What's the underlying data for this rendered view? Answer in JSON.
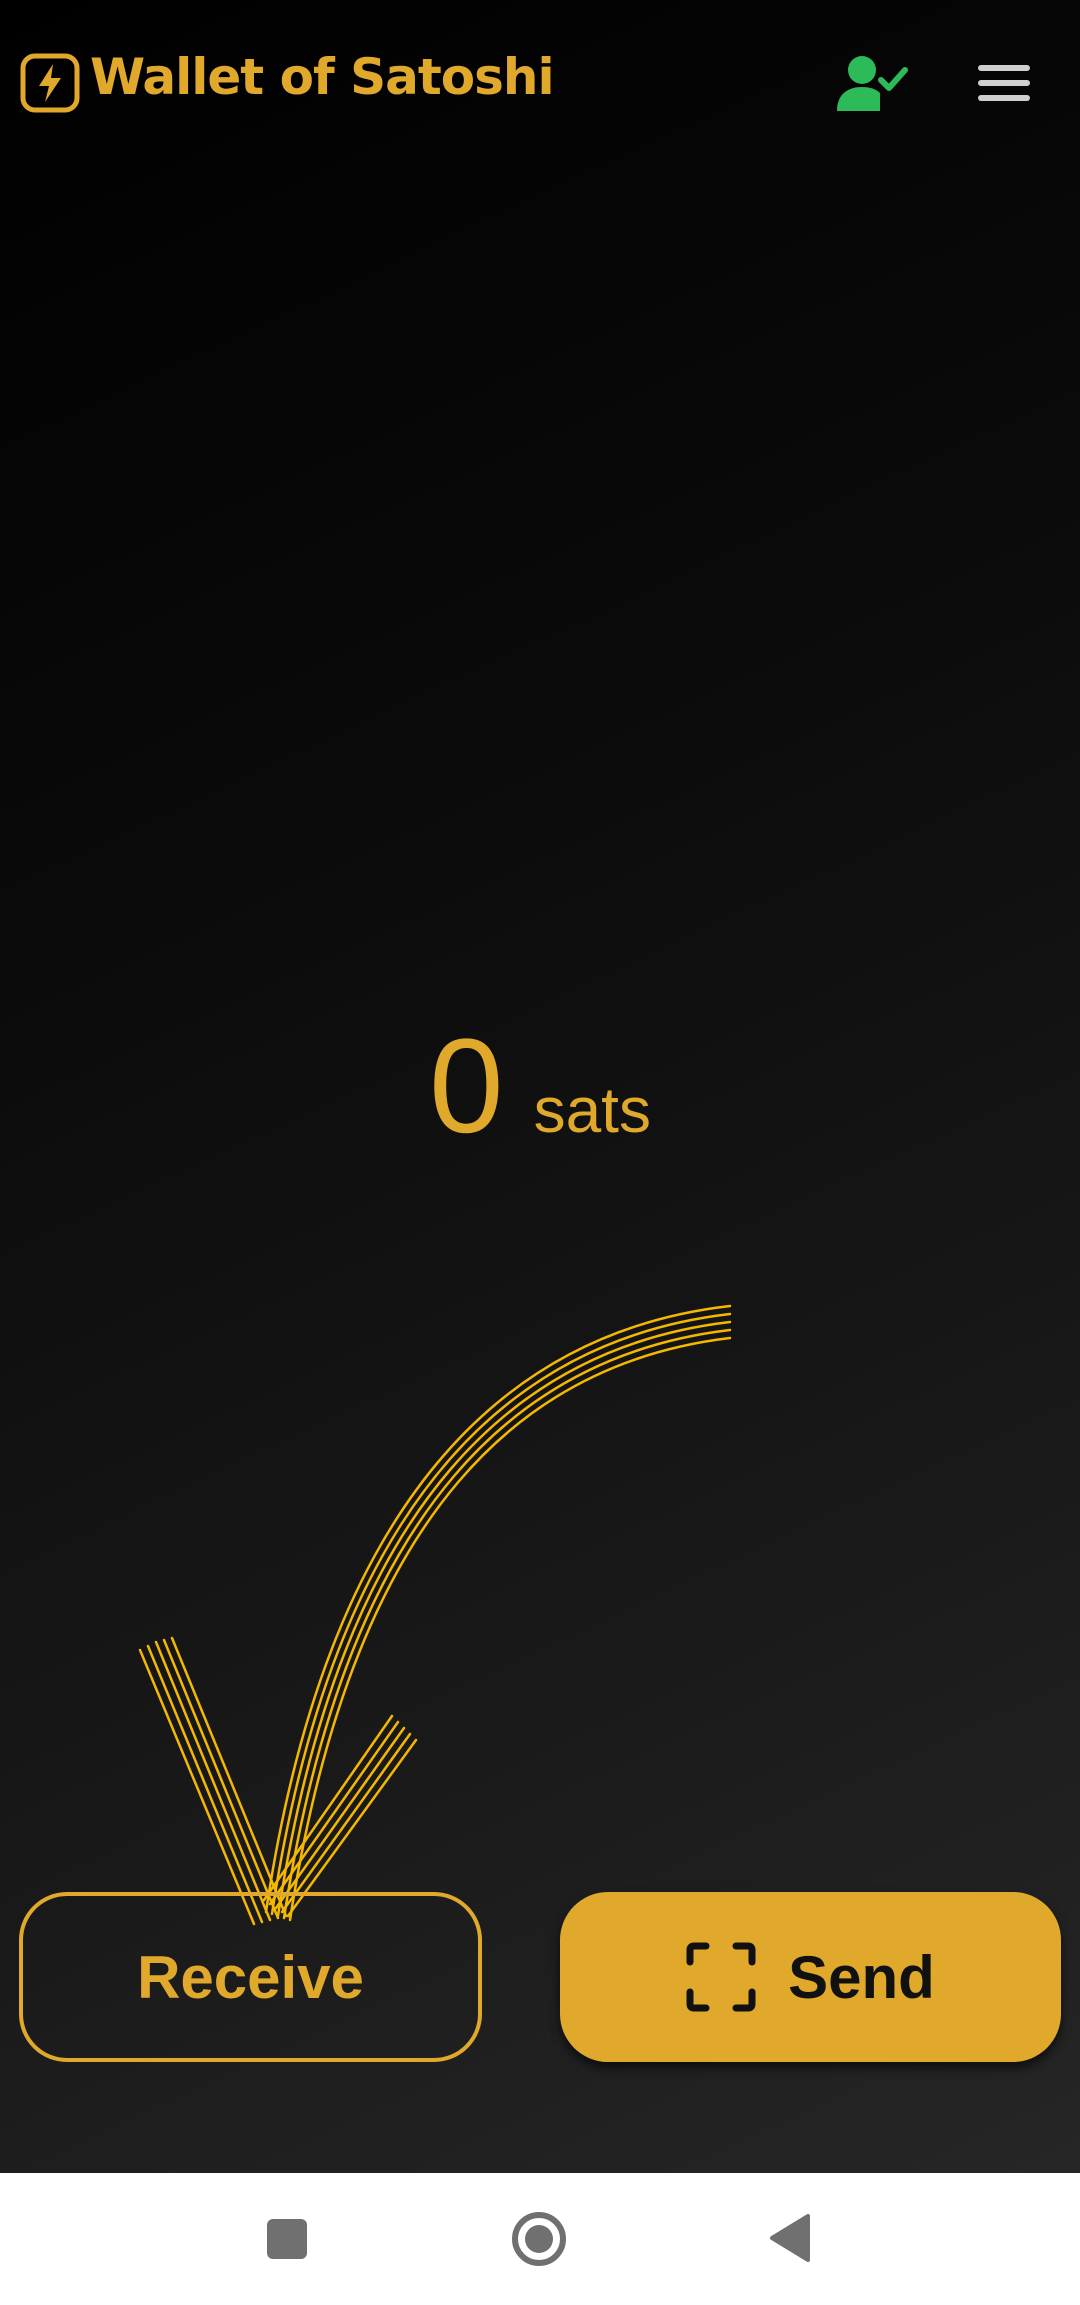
{
  "header": {
    "app_title": "Wallet of Satoshi",
    "logo_icon": "lightning-bolt-icon",
    "account_icon": "user-verified-icon",
    "menu_icon": "hamburger-menu-icon"
  },
  "balance": {
    "amount": "0",
    "unit": "sats"
  },
  "actions": {
    "receive_label": "Receive",
    "send_label": "Send",
    "send_icon": "scan-icon"
  },
  "navbar": {
    "recents_icon": "square-icon",
    "home_icon": "circle-home-icon",
    "back_icon": "triangle-back-icon"
  },
  "colors": {
    "accent": "#e0a92b",
    "verified_green": "#2dbb5a",
    "arrow_yellow": "#f5b800",
    "background": "#000000"
  }
}
